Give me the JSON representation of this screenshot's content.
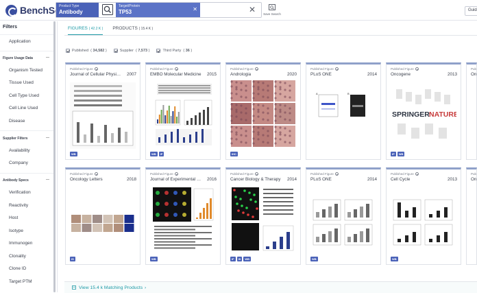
{
  "header": {
    "logo_text": "BenchSci",
    "search": {
      "chip1": {
        "label": "Product Type",
        "value": "Antibody"
      },
      "chip2": {
        "label": "Target/Protein",
        "value": "TP53"
      }
    },
    "save_search_label": "Save Search",
    "guide_label": "Guide"
  },
  "sidebar": {
    "title": "Filters",
    "items_top": [
      "Application"
    ],
    "figure_usage_section": "Figure Usage Data",
    "figure_usage_items": [
      "Organism Tested",
      "Tissue Used",
      "Cell Type Used",
      "Cell Line Used",
      "Disease"
    ],
    "supplier_section": "Supplier Filters",
    "supplier_items": [
      "Availability",
      "Company"
    ],
    "antibody_section": "Antibody Specs",
    "antibody_items": [
      "Verification",
      "Reactivity",
      "Host",
      "Isotype",
      "Immunogen",
      "Clonality",
      "Clone ID",
      "Target PTM"
    ]
  },
  "tabs": [
    {
      "label": "FIGURES",
      "count": "42.2 K",
      "active": true
    },
    {
      "label": "PRODUCTS",
      "count": "15.4 K",
      "active": false
    }
  ],
  "filters": [
    {
      "label": "Published",
      "count": "34,582"
    },
    {
      "label": "Supplier",
      "count": "7,573"
    },
    {
      "label": "Third Party",
      "count": "36"
    }
  ],
  "cards": [
    {
      "kicker": "Published Figure",
      "journal": "Journal of Cellular Physiology",
      "year": "2007",
      "tags": [
        "WB"
      ],
      "thumb": "blots"
    },
    {
      "kicker": "Published Figure",
      "journal": "EMBO Molecular Medicine",
      "year": "2015",
      "tags": [
        "WB",
        "IP"
      ],
      "thumb": "bars"
    },
    {
      "kicker": "Published Figure",
      "journal": "Andrologia",
      "year": "2020",
      "tags": [
        "IHC"
      ],
      "thumb": "tissue"
    },
    {
      "kicker": "Published Figure",
      "journal": "PLoS ONE",
      "year": "2014",
      "tags": [],
      "thumb": "gel"
    },
    {
      "kicker": "Published Figure",
      "journal": "Oncogene",
      "year": "2013",
      "tags": [
        "IP",
        "WB"
      ],
      "thumb": "springer",
      "thumb_text_1": "SPRINGER",
      "thumb_text_2": "NATURE"
    },
    {
      "kicker": "Published Figure",
      "journal": "Oncology Letters",
      "year": "2018",
      "tags": [
        "IS"
      ],
      "thumb": "micro"
    },
    {
      "kicker": "Published Figure",
      "journal": "Journal of Experimental & Clini...",
      "year": "2016",
      "tags": [
        "WB"
      ],
      "thumb": "fluor"
    },
    {
      "kicker": "Published Figure",
      "journal": "Cancer Biology & Therapy",
      "year": "2014",
      "tags": [
        "IF",
        "IS",
        "WB"
      ],
      "thumb": "flow"
    },
    {
      "kicker": "Published Figure",
      "journal": "PLoS ONE",
      "year": "2014",
      "tags": [
        "WB"
      ],
      "thumb": "bars2"
    },
    {
      "kicker": "Published Figure",
      "journal": "Cell Cycle",
      "year": "2013",
      "tags": [
        "WB"
      ],
      "thumb": "bars3"
    }
  ],
  "partial_cards": [
    {
      "kicker": "Publish",
      "journal": "Onc"
    },
    {
      "kicker": "Publish",
      "journal": "Onc"
    }
  ],
  "bottom_bar": {
    "label": "View 15.4 k Matching Products"
  },
  "colors": {
    "accent": "#1d9aa6",
    "brand": "#4a62b8",
    "card_top": "#8fa0c9"
  }
}
